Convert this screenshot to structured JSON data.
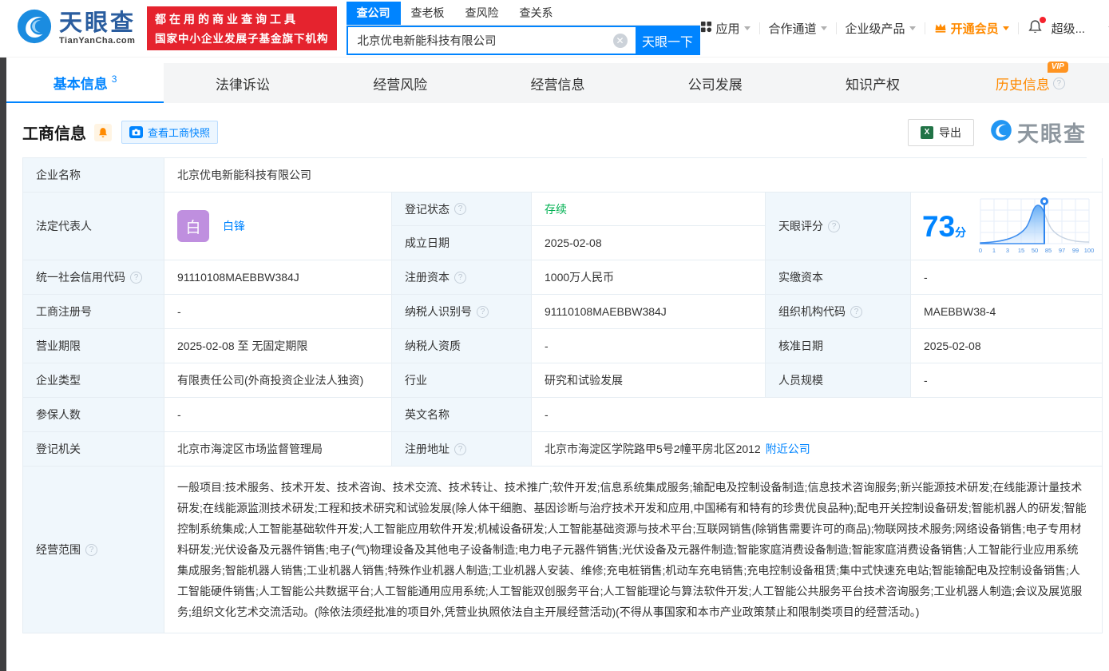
{
  "brand": {
    "name": "天眼查",
    "domain": "TianYanCha.com",
    "slogan_line1": "都在用的商业查询工具",
    "slogan_line2": "国家中小企业发展子基金旗下机构"
  },
  "search": {
    "tabs": [
      {
        "label": "查公司"
      },
      {
        "label": "查老板"
      },
      {
        "label": "查风险"
      },
      {
        "label": "查关系"
      }
    ],
    "value": "北京优电新能科技有限公司",
    "button": "天眼一下"
  },
  "nav": {
    "apps": "应用",
    "cooperation": "合作通道",
    "enterprise": "企业级产品",
    "vip": "开通会员",
    "super": "超级..."
  },
  "tabs": {
    "basic": "基本信息",
    "basic_count": "3",
    "legal": "法律诉讼",
    "risk": "经营风险",
    "business": "经营信息",
    "development": "公司发展",
    "ip": "知识产权",
    "history": "历史信息",
    "history_badge": "VIP"
  },
  "section": {
    "title": "工商信息",
    "snapshot_button": "查看工商快照",
    "export_button": "导出",
    "watermark": "天眼查"
  },
  "table": {
    "company_name": {
      "label": "企业名称",
      "value": "北京优电新能科技有限公司"
    },
    "legal_rep": {
      "label": "法定代表人",
      "avatar": "白",
      "value": "白锋"
    },
    "reg_status": {
      "label": "登记状态",
      "value": "存续"
    },
    "establish_date": {
      "label": "成立日期",
      "value": "2025-02-08"
    },
    "score": {
      "label": "天眼评分",
      "value": "73",
      "unit": "分",
      "marker_value": 73,
      "ticks": [
        "0",
        "1",
        "3",
        "15",
        "50",
        "85",
        "97",
        "99",
        "100"
      ]
    },
    "credit_code": {
      "label": "统一社会信用代码",
      "value": "91110108MAEBBW384J"
    },
    "reg_capital": {
      "label": "注册资本",
      "value": "1000万人民币"
    },
    "paid_capital": {
      "label": "实缴资本",
      "value": "-"
    },
    "reg_number": {
      "label": "工商注册号",
      "value": "-"
    },
    "taxpayer_id": {
      "label": "纳税人识别号",
      "value": "91110108MAEBBW384J"
    },
    "org_code": {
      "label": "组织机构代码",
      "value": "MAEBBW38-4"
    },
    "business_term": {
      "label": "营业期限",
      "value": "2025-02-08 至 无固定期限"
    },
    "taxpayer_quality": {
      "label": "纳税人资质",
      "value": "-"
    },
    "approval_date": {
      "label": "核准日期",
      "value": "2025-02-08"
    },
    "company_type": {
      "label": "企业类型",
      "value": "有限责任公司(外商投资企业法人独资)"
    },
    "industry": {
      "label": "行业",
      "value": "研究和试验发展"
    },
    "staff_size": {
      "label": "人员规模",
      "value": "-"
    },
    "insured_count": {
      "label": "参保人数",
      "value": "-"
    },
    "english_name": {
      "label": "英文名称",
      "value": "-"
    },
    "reg_authority": {
      "label": "登记机关",
      "value": "北京市海淀区市场监督管理局"
    },
    "reg_address": {
      "label": "注册地址",
      "value": "北京市海淀区学院路甲5号2幢平房北区2012",
      "link": "附近公司"
    },
    "business_scope": {
      "label": "经营范围",
      "value": "一般项目:技术服务、技术开发、技术咨询、技术交流、技术转让、技术推广;软件开发;信息系统集成服务;输配电及控制设备制造;信息技术咨询服务;新兴能源技术研发;在线能源计量技术研发;在线能源监测技术研发;工程和技术研究和试验发展(除人体干细胞、基因诊断与治疗技术开发和应用,中国稀有和特有的珍贵优良品种);配电开关控制设备研发;智能机器人的研发;智能控制系统集成;人工智能基础软件开发;人工智能应用软件开发;机械设备研发;人工智能基础资源与技术平台;互联网销售(除销售需要许可的商品);物联网技术服务;网络设备销售;电子专用材料研发;光伏设备及元器件销售;电子(气)物理设备及其他电子设备制造;电力电子元器件销售;光伏设备及元器件制造;智能家庭消费设备制造;智能家庭消费设备销售;人工智能行业应用系统集成服务;智能机器人销售;工业机器人销售;特殊作业机器人制造;工业机器人安装、维修;充电桩销售;机动车充电销售;充电控制设备租赁;集中式快速充电站;智能输配电及控制设备销售;人工智能硬件销售;人工智能公共数据平台;人工智能通用应用系统;人工智能双创服务平台;人工智能理论与算法软件开发;人工智能公共服务平台技术咨询服务;工业机器人制造;会议及展览服务;组织文化艺术交流活动。(除依法须经批准的项目外,凭营业执照依法自主开展经营活动)(不得从事国家和本市产业政策禁止和限制类项目的经营活动。)"
    }
  },
  "colors": {
    "accent": "#0084ff",
    "status_green": "#00b152",
    "vip_orange": "#ff8a00",
    "brand_red": "#e5232e"
  }
}
